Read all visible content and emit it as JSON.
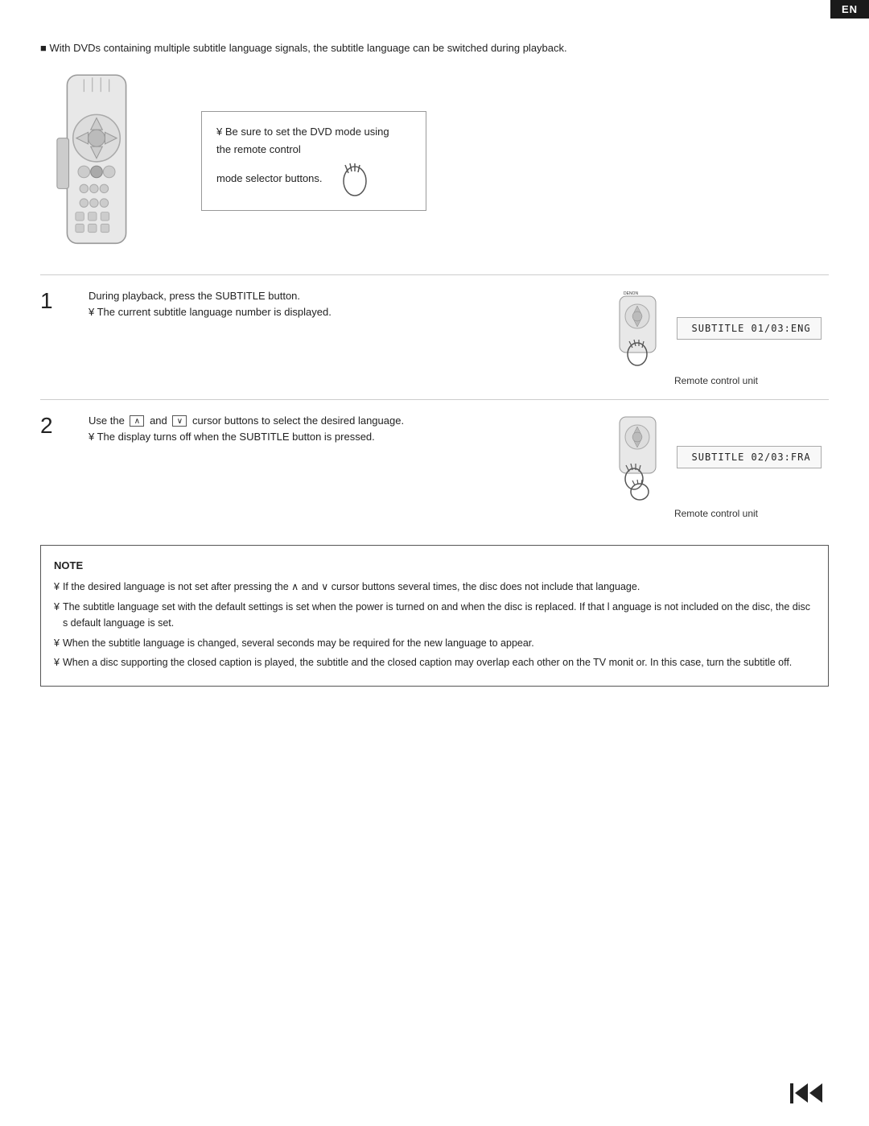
{
  "badge": {
    "label": "EN"
  },
  "intro": {
    "text": "With DVDs containing multiple subtitle language signals, the subtitle language can be switched during playback."
  },
  "dvd_note": {
    "line1": "¥ Be sure to set the DVD mode using",
    "line2": "the remote control",
    "line3": "mode selector buttons."
  },
  "step1": {
    "number": "1",
    "main_text": "During playback, press the SUBTITLE button.",
    "note_text": "¥ The current subtitle language number is displayed.",
    "subtitle_display": "SUBTITLE   01/03:ENG",
    "remote_label": "Remote control unit"
  },
  "step2": {
    "number": "2",
    "main_text1": "Use the",
    "cursor_up": "∧",
    "and": "and",
    "cursor_down": "∨",
    "main_text2": "cursor buttons to select the desired language.",
    "note1": "¥ The display turns off when the SUBTITLE button is pressed.",
    "subtitle_display": "SUBTITLE   02/03:FRA",
    "remote_label": "Remote control unit"
  },
  "note_box": {
    "title": "NOTE",
    "items": [
      "If the desired language is not set after pressing the  ∧  and  ∨ cursor buttons several times, the disc does not include that language.",
      "The subtitle language set with the default settings is set when the power is turned on and when the disc is replaced. If that l  anguage is not included on the disc, the disc s default language is set.",
      "When the subtitle language is changed, several seconds may be required for the new language to appear.",
      "When a disc supporting the closed caption is played, the subtitle and the closed caption may overlap each other on the TV monit or. In this case, turn the subtitle off."
    ]
  }
}
